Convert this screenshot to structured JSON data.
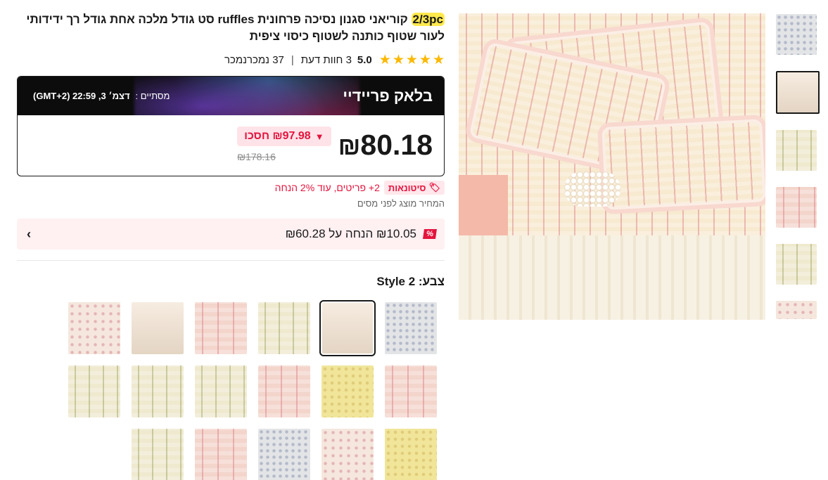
{
  "product": {
    "title_highlight": "2/3pc",
    "title_rest": " קוריאני סגנון נסיכה פרחונית ruffles סט גודל מלכה אחת גודל רך ידידותי לעור שטוף כותנה לשטוף כיסוי ציפית",
    "rating": {
      "stars": 5,
      "score": "5.0",
      "reviews": "3 חוות דעת",
      "separator": "|",
      "sold": "37 נמכרנמכר"
    }
  },
  "deal": {
    "label": "בלאק פריידיי",
    "ends_label": "מסתיים :",
    "ends_value": "דצמ׳ 3, 22:59 (GMT+2)",
    "price": "80.18",
    "currency": "₪",
    "save_text": "₪97.98 חסכו",
    "old_price": "₪178.16"
  },
  "coupon": {
    "tag": "סיטונאות",
    "text": "2+ פריטים, עוד 2% הנחה"
  },
  "tax_note": "המחיר מוצג לפני מסים",
  "discount": {
    "badge": "%",
    "text": "₪10.05 הנחה על ₪60.28"
  },
  "color": {
    "label": "צבע:",
    "selected": "Style 2"
  },
  "gallery": {
    "thumbs": [
      "fab blue",
      "fab plain",
      "fab green",
      "fab pink",
      "fab green",
      "fab floral"
    ],
    "active_index": 1
  },
  "swatches": [
    {
      "style": "fab blue"
    },
    {
      "style": "fab plain",
      "selected": true
    },
    {
      "style": "fab green"
    },
    {
      "style": "fab pink"
    },
    {
      "style": "fab plain"
    },
    {
      "style": "fab floral"
    },
    {
      "style": "fab pink"
    },
    {
      "style": "fab yellow"
    },
    {
      "style": "fab pink"
    },
    {
      "style": "fab green"
    },
    {
      "style": "fab green"
    },
    {
      "style": "fab green"
    },
    {
      "style": "fab yellow"
    },
    {
      "style": "fab floral"
    },
    {
      "style": "fab blue"
    },
    {
      "style": "fab pink"
    },
    {
      "style": "fab green"
    }
  ],
  "colors": {
    "accent_red": "#e3143d",
    "star": "#fdb800",
    "deal_bg": "#0c0c0c"
  }
}
